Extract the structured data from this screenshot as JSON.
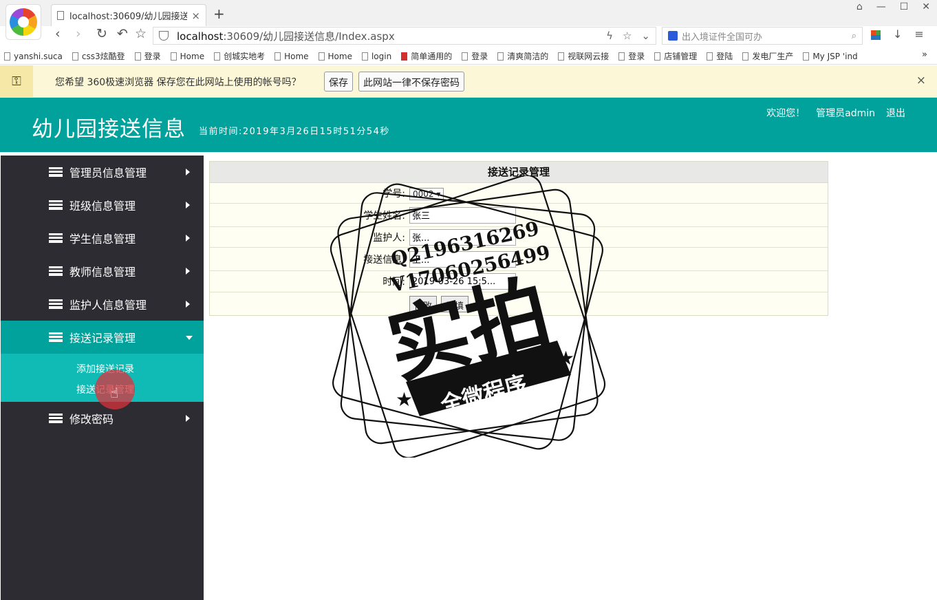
{
  "browser": {
    "tab_title": "localhost:30609/幼儿园接送信息",
    "tab_close": "×",
    "new_tab": "+",
    "window_controls": [
      "⌂",
      "—",
      "☐",
      "✕"
    ],
    "url_host": "localhost",
    "url_path": ":30609/幼儿园接送信息/Index.aspx",
    "search_placeholder": "出入境证件全国可办",
    "bookmarks": [
      "yanshi.suca",
      "css3炫酷登",
      "登录",
      "Home",
      "创城实地考",
      "Home",
      "Home",
      "login",
      "简单通用的",
      "登录",
      "清爽简洁的",
      "视联网云接",
      "登录",
      "店铺管理",
      "登陆",
      "发电厂生产",
      "My JSP 'ind"
    ],
    "bookmarks_more": "»",
    "password_prompt": {
      "message": "您希望 360极速浏览器 保存您在此网站上使用的帐号吗？",
      "save": "保存",
      "never": "此网站一律不保存密码",
      "close": "×"
    }
  },
  "header": {
    "title": "幼儿园接送信息",
    "time": "当前时间:2019年3月26日15时51分54秒",
    "welcome": "欢迎您！",
    "user": "管理员admin",
    "logout": "退出"
  },
  "sidebar": {
    "items": [
      {
        "label": "管理员信息管理"
      },
      {
        "label": "班级信息管理"
      },
      {
        "label": "学生信息管理"
      },
      {
        "label": "教师信息管理"
      },
      {
        "label": "监护人信息管理"
      },
      {
        "label": "接送记录管理"
      },
      {
        "label": "修改密码"
      }
    ],
    "submenu": [
      "添加接送记录",
      "接送记录管理"
    ]
  },
  "form": {
    "title": "接送记录管理",
    "fields": [
      {
        "label": "学号:",
        "value": "0002"
      },
      {
        "label": "学生姓名:",
        "value": "张三"
      },
      {
        "label": "监护人:",
        "value": "张..."
      },
      {
        "label": "接送信息:",
        "value": "王..."
      },
      {
        "label": "时间:",
        "value": "2019-03-26 15:5..."
      }
    ],
    "submit": "修改",
    "reset": "重填"
  },
  "stamp": {
    "line1": "Q2196316269",
    "line2": "V17060256499",
    "big": "实拍",
    "banner": "全微程序"
  }
}
